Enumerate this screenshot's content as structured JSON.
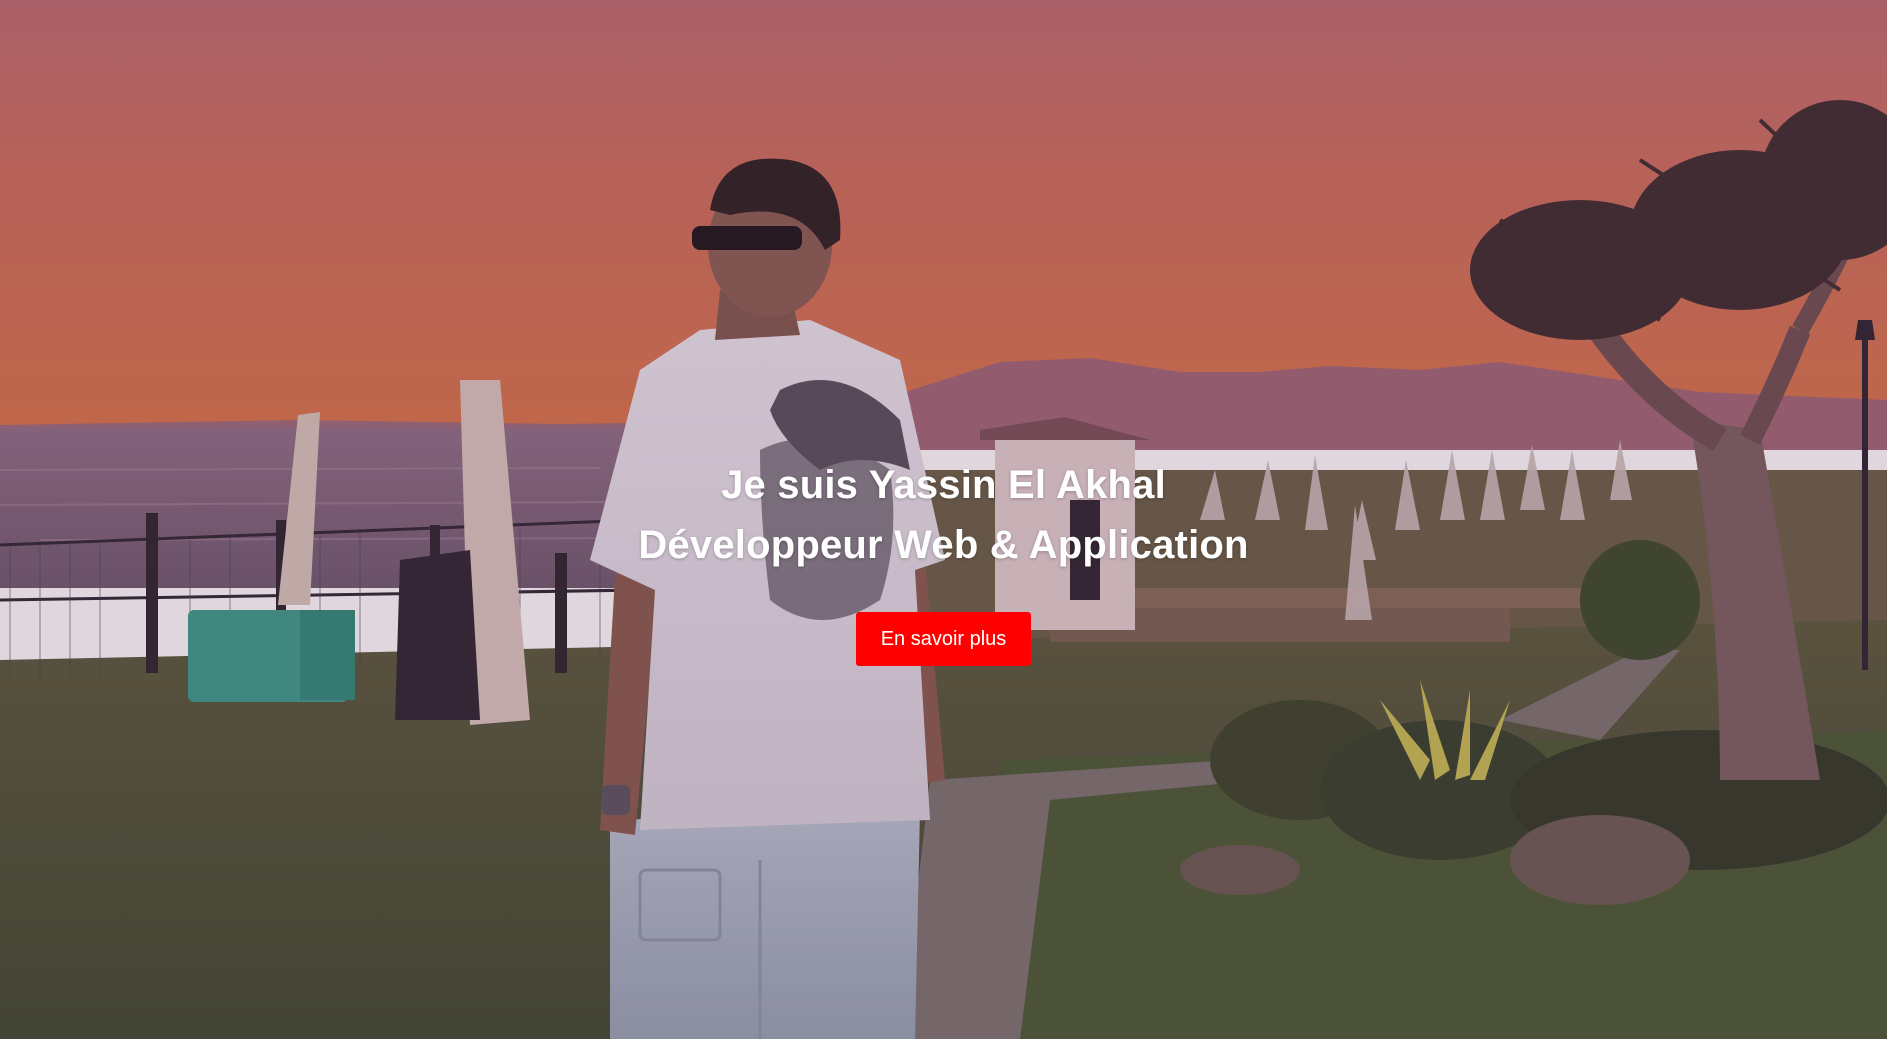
{
  "hero": {
    "title_line1": "Je suis Yassin El Akhal",
    "title_line2": "Développeur Web & Application",
    "cta_label": "En savoir plus"
  },
  "colors": {
    "cta_background": "#ff0000",
    "text": "#ffffff",
    "sky_top": "#c06a6c",
    "sky_horizon": "#d9704e"
  }
}
